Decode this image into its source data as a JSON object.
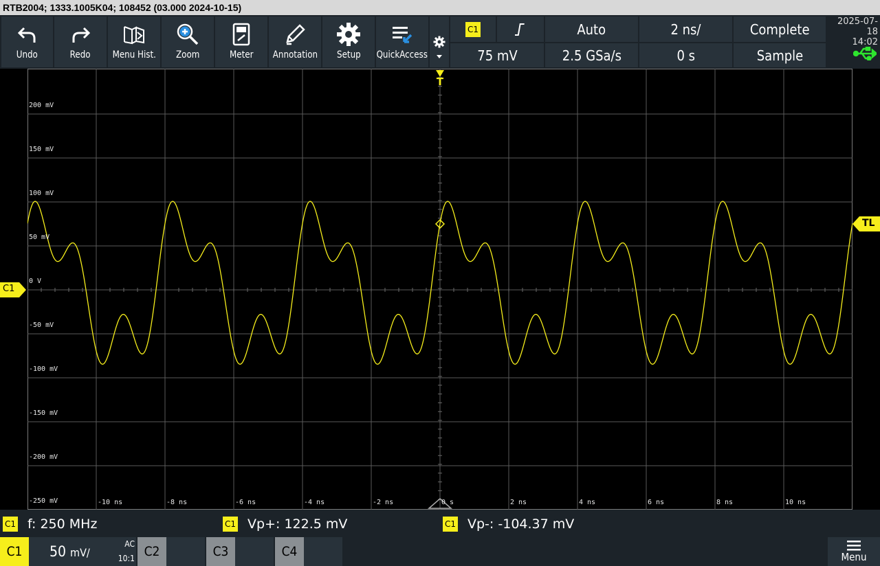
{
  "title_bar": "RTB2004; 1333.1005K04; 108452 (03.000 2024-10-15)",
  "toolbar": [
    {
      "id": "undo",
      "label": "Undo",
      "icon": "undo-arrow"
    },
    {
      "id": "redo",
      "label": "Redo",
      "icon": "redo-arrow"
    },
    {
      "id": "menu-hist",
      "label": "Menu Hist.",
      "icon": "menu-history"
    },
    {
      "id": "zoom",
      "label": "Zoom",
      "icon": "zoom-in"
    },
    {
      "id": "meter",
      "label": "Meter",
      "icon": "meter"
    },
    {
      "id": "annotation",
      "label": "Annotation",
      "icon": "pencil"
    },
    {
      "id": "setup",
      "label": "Setup",
      "icon": "gear"
    },
    {
      "id": "quickaccess",
      "label": "QuickAccess",
      "icon": "quick-access"
    }
  ],
  "trigger": {
    "source": "C1",
    "slope": "rising",
    "mode": "Auto",
    "level": "75 mV"
  },
  "acquisition": {
    "sample_rate": "2.5 GSa/s",
    "time_scale": "2 ns/",
    "position": "0 s",
    "state": "Complete",
    "mode": "Sample"
  },
  "clock": {
    "date": "2025-07-18",
    "time": "14:02"
  },
  "usb_icon_color": "#2ee52e",
  "channel_color": "#f6ee1b",
  "trigger_marker": "T",
  "trigger_level_marker": "TL",
  "channel_marker": "C1",
  "y_labels": [
    "200 mV",
    "150 mV",
    "100 mV",
    "50 mV",
    "0 V",
    "-50 mV",
    "-100 mV",
    "-150 mV",
    "-200 mV",
    "-250 mV"
  ],
  "x_labels": [
    "-10 ns",
    "-8 ns",
    "-6 ns",
    "-4 ns",
    "-2 ns",
    "0 s",
    "2 ns",
    "4 ns",
    "6 ns",
    "8 ns",
    "10 ns"
  ],
  "measurements": [
    {
      "source": "C1",
      "label": "f:",
      "value": "250 MHz"
    },
    {
      "source": "C1",
      "label": "Vp+:",
      "value": "122.5 mV"
    },
    {
      "source": "C1",
      "label": "Vp-:",
      "value": "-104.37 mV"
    }
  ],
  "channels": {
    "c1": {
      "name": "C1",
      "scale": "50",
      "unit": "mV/",
      "coupling": "AC",
      "probe": "10:1"
    },
    "c2": {
      "name": "C2"
    },
    "c3": {
      "name": "C3"
    },
    "c4": {
      "name": "C4"
    }
  },
  "menu_label": "Menu",
  "chart_data": {
    "type": "line",
    "x_range_ns": [
      -12,
      12
    ],
    "y_range_mV": [
      -250,
      250
    ],
    "grid": true,
    "series": [
      {
        "name": "C1",
        "fundamental_MHz": 250,
        "vpp_plus_mV": 122.5,
        "vp_minus_mV": -104.37
      }
    ]
  }
}
